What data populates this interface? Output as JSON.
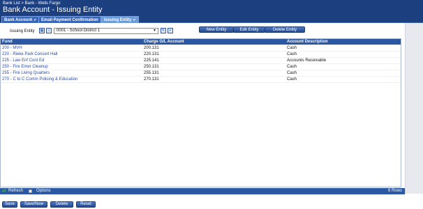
{
  "header": {
    "breadcrumb": "Bank List > Bank - Wells Fargo",
    "title": "Bank Account - Issuing Entity"
  },
  "tabs": [
    {
      "label": "Bank Account",
      "active": false
    },
    {
      "label": "Email Payment Confirmation",
      "active": false
    },
    {
      "label": "Issuing Entity",
      "active": true
    }
  ],
  "entity": {
    "label": "Issuing Entity",
    "selected": "0001 - School District 1"
  },
  "actions": {
    "new": "New Entity",
    "edit": "Edit Entity",
    "delete": "Delete Entity"
  },
  "table": {
    "columns": [
      "Fund",
      "Charge G/L Account",
      "Account Description"
    ],
    "rows": [
      [
        "200 - MVH",
        "200.131",
        "Cash"
      ],
      [
        "220 - Rieke Park Concert Hall",
        "220.131",
        "Cash"
      ],
      [
        "225 - Law Enf Cont Ed",
        "225.141",
        "Accounts Receivable"
      ],
      [
        "250 - Fire Emer Cleanup",
        "250.131",
        "Cash"
      ],
      [
        "255 - Fire Living Quarters",
        "255.131",
        "Cash"
      ],
      [
        "270 - C to C Comm Policing & Education",
        "270.131",
        "Cash"
      ]
    ]
  },
  "footer": {
    "refresh": "Refresh",
    "options": "Options",
    "row_count": "6 Rows"
  },
  "buttons": {
    "save": "Save",
    "save_new": "Save/New",
    "delete": "Delete",
    "reset": "Reset"
  },
  "colors": {
    "header_bg": "#1c3f80",
    "grid_header": "#2b57a3",
    "link": "#2a4ba6"
  }
}
